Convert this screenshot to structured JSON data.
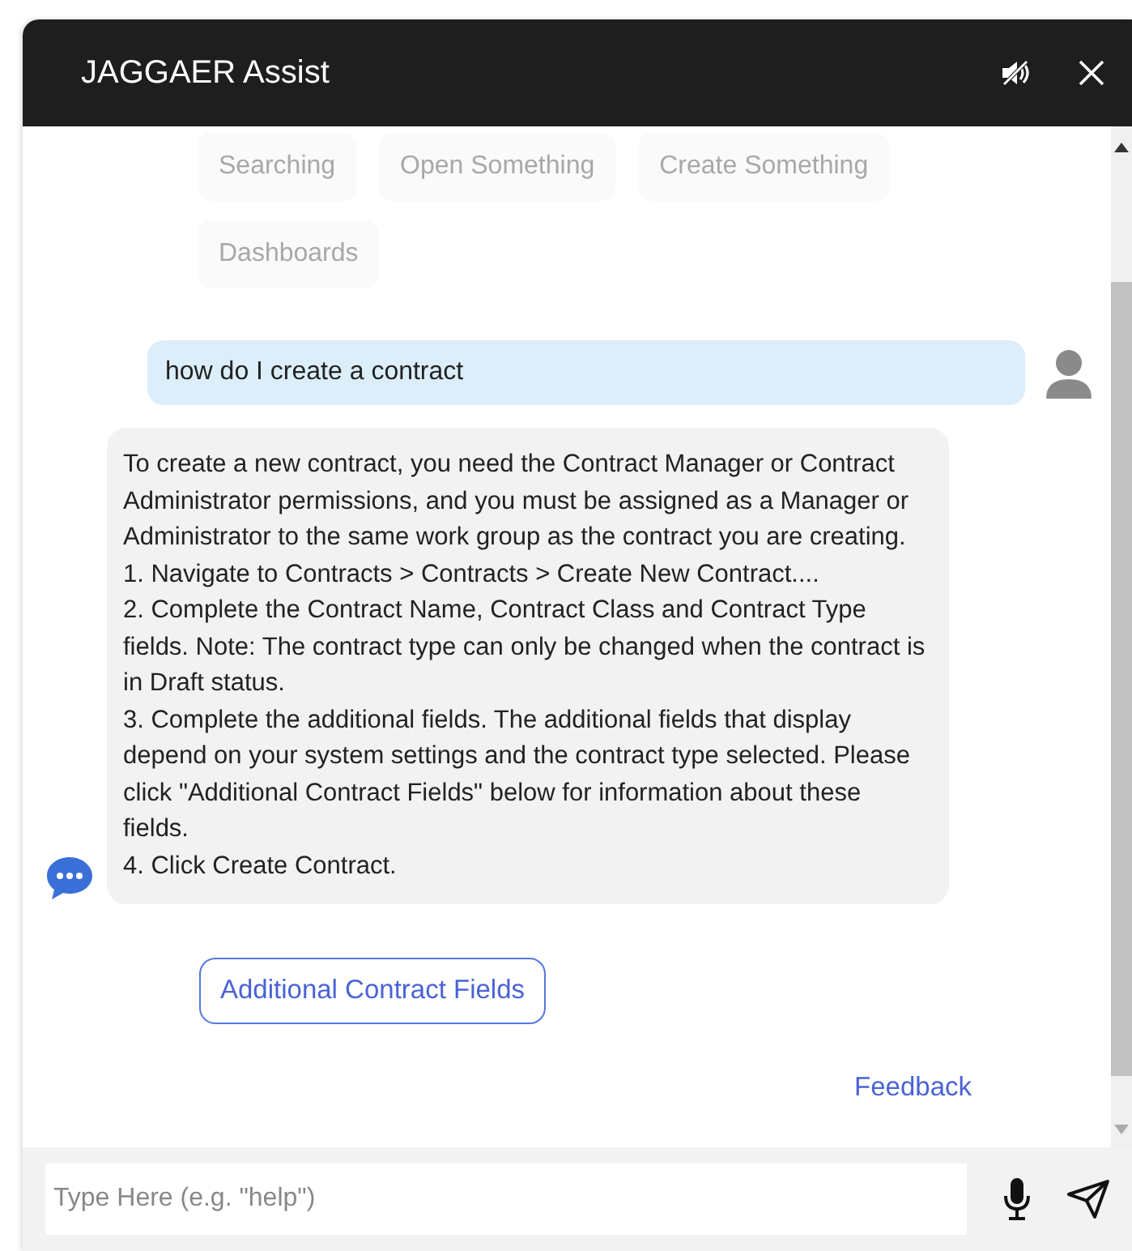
{
  "window": {
    "title": "JAGGAER Assist"
  },
  "quick_replies": [
    "Searching",
    "Open Something",
    "Create Something",
    "Dashboards"
  ],
  "messages": [
    {
      "kind": "user",
      "text": "how do I create a contract"
    },
    {
      "kind": "bot",
      "lines": [
        "To create a new contract, you need the Contract Manager or Contract Administrator permissions, and you must be assigned as a Manager or Administrator to the same work group as the contract you are creating.",
        "1. Navigate to Contracts > Contracts > Create New Contract....",
        "2. Complete the Contract Name, Contract Class and Contract Type fields. Note: The contract type can only be changed when the contract is in Draft status.",
        "3. Complete the additional fields. The additional fields that display depend on your system settings and the contract type selected. Please click \"Additional Contract Fields\" below for information about these fields.",
        "4. Click Create Contract."
      ]
    }
  ],
  "action_button": "Additional Contract Fields",
  "feedback_link": "Feedback",
  "input": {
    "placeholder": "Type Here (e.g. \"help\")"
  }
}
